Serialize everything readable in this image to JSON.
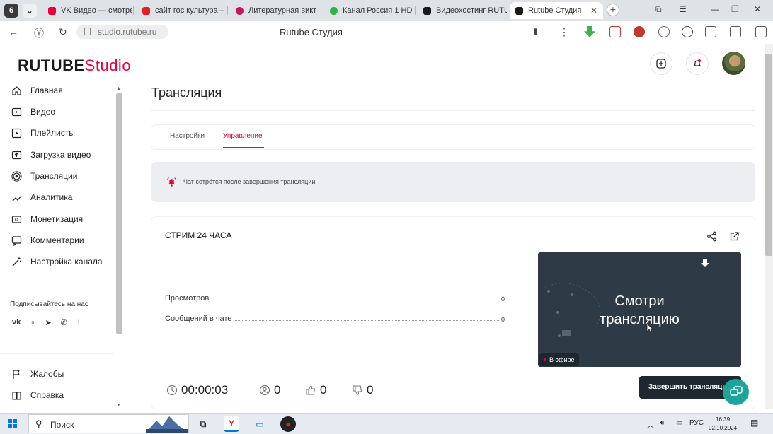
{
  "browser": {
    "tab_counter": "6",
    "tabs": [
      {
        "title": "VK Видео — смотре",
        "color": "#e6003c"
      },
      {
        "title": "сайт гос культура –",
        "color": "#e31e24"
      },
      {
        "title": "Литературная викт",
        "color": "#c2185b"
      },
      {
        "title": "Канал Россия 1 HD",
        "color": "#2bb34a"
      },
      {
        "title": "Видеохостинг RUTU",
        "color": "#1a1a1a"
      },
      {
        "title": "Rutube Студия",
        "color": "#1a1a1a"
      }
    ],
    "url": "studio.rutube.ru",
    "page_title": "Rutube Студия"
  },
  "header": {
    "logo_main": "RUTUBE",
    "logo_sub": "Studio"
  },
  "sidebar": {
    "items": [
      {
        "label": "Главная",
        "icon": "home-icon"
      },
      {
        "label": "Видео",
        "icon": "video-icon"
      },
      {
        "label": "Плейлисты",
        "icon": "playlist-icon"
      },
      {
        "label": "Загрузка видео",
        "icon": "upload-icon"
      },
      {
        "label": "Трансляции",
        "icon": "broadcast-icon"
      },
      {
        "label": "Аналитика",
        "icon": "analytics-icon"
      },
      {
        "label": "Монетизация",
        "icon": "monetization-icon"
      },
      {
        "label": "Комментарии",
        "icon": "comments-icon"
      },
      {
        "label": "Настройка канала",
        "icon": "settings-wand-icon"
      }
    ],
    "social_title": "Подписывайтесь на нас",
    "socials": [
      "vk-icon",
      "ok-icon",
      "telegram-icon",
      "viber-icon",
      "plus-icon"
    ],
    "bottom_items": [
      {
        "label": "Жалобы",
        "icon": "flag-icon"
      },
      {
        "label": "Справка",
        "icon": "help-icon"
      }
    ]
  },
  "main": {
    "title": "Трансляция",
    "tabs": [
      {
        "label": "Настройки",
        "active": false
      },
      {
        "label": "Управление",
        "active": true
      }
    ],
    "notice": "Чат сотрётся после завершения трансляции",
    "stream": {
      "title": "СТРИМ 24 ЧАСА",
      "stats": [
        {
          "label": "Просмотров",
          "value": "0"
        },
        {
          "label": "Сообщений в чате",
          "value": "0"
        }
      ],
      "preview_text": [
        "Смотри",
        "трансляцию"
      ],
      "live_label": "В эфире",
      "duration": "00:00:03",
      "viewers": "0",
      "likes": "0",
      "dislikes": "0",
      "end_button": "Завершить трансляцию"
    }
  },
  "taskbar": {
    "search_label": "Поиск",
    "lang": "РУС",
    "time": "16:39",
    "date": "02.10.2024"
  },
  "colors": {
    "accent": "#e6003c",
    "dark_button": "#1f2730",
    "support": "#1ea59a",
    "preview_bg": "#2e3b47"
  }
}
